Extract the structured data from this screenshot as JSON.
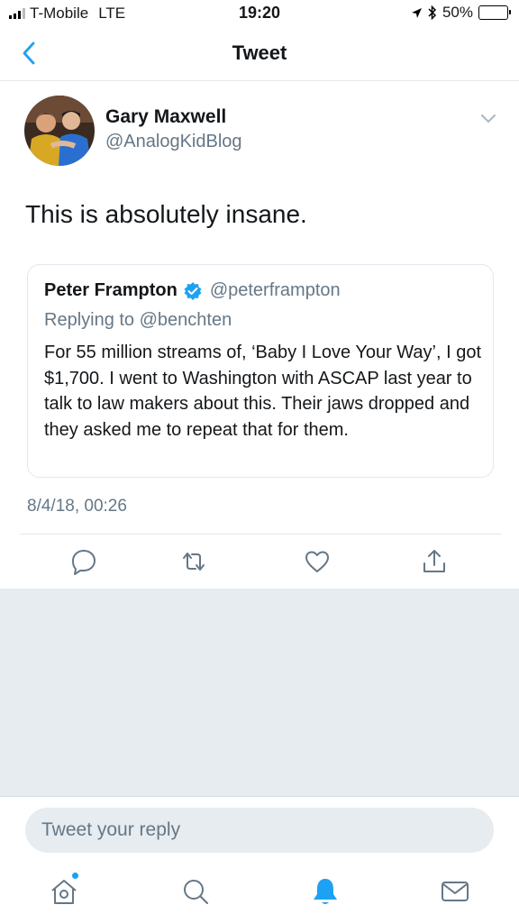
{
  "status_bar": {
    "carrier": "T-Mobile",
    "network": "LTE",
    "time": "19:20",
    "battery": "50%"
  },
  "nav": {
    "title": "Tweet",
    "back_icon": "chevron-left-icon"
  },
  "tweet": {
    "author_name": "Gary Maxwell",
    "author_handle": "@AnalogKidBlog",
    "text": "This is absolutely insane.",
    "timestamp": "8/4/18, 00:26",
    "quoted": {
      "name": "Peter Frampton",
      "verified": true,
      "handle": "@peterframpton",
      "replying_to": "Replying to @benchten",
      "text": "For 55 million streams of, ‘Baby I Love Your Way’, I got $1,700. I went to Washington with ASCAP last year to talk to law makers about this. Their jaws dropped and they asked me to repeat that for them."
    }
  },
  "actions": [
    "reply-icon",
    "retweet-icon",
    "like-icon",
    "share-icon"
  ],
  "reply": {
    "placeholder": "Tweet your reply"
  },
  "tabs": [
    "home-icon",
    "search-icon",
    "notifications-icon",
    "messages-icon"
  ],
  "colors": {
    "accent": "#1da1f2",
    "secondary_text": "#657786",
    "background_gray": "#e6ecf0"
  }
}
